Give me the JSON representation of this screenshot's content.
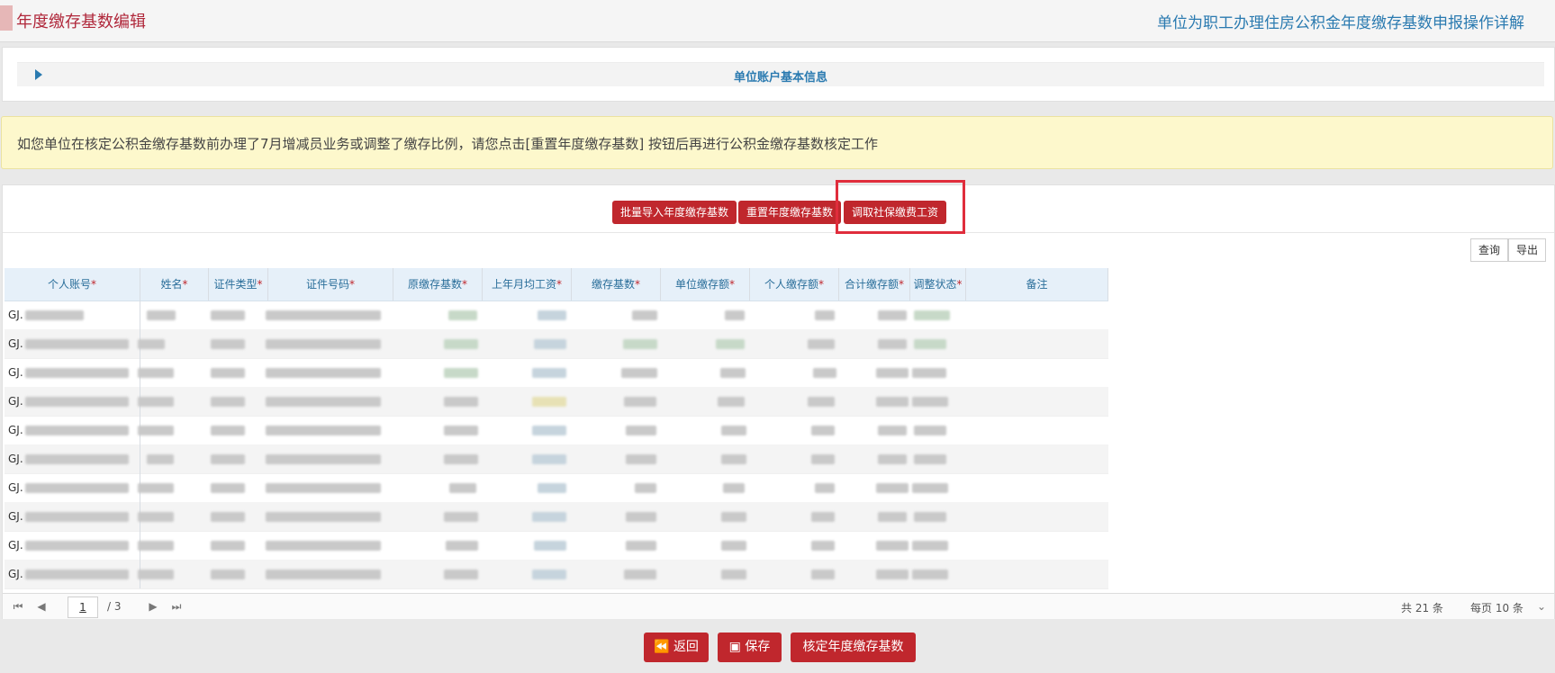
{
  "page": {
    "title": "年度缴存基数编辑",
    "help_link": "单位为职工办理住房公积金年度缴存基数申报操作详解"
  },
  "info_panel": {
    "label": "单位账户基本信息"
  },
  "notice": "如您单位在核定公积金缴存基数前办理了7月增减员业务或调整了缴存比例，请您点击[重置年度缴存基数] 按钮后再进行公积金缴存基数核定工作",
  "toolbar": {
    "import_label": "批量导入年度缴存基数",
    "reset_label": "重置年度缴存基数",
    "fetch_label": "调取社保缴费工资"
  },
  "query": {
    "search_label": "查询",
    "export_label": "导出"
  },
  "columns": [
    "个人账号",
    "姓名",
    "证件类型",
    "证件号码",
    "原缴存基数",
    "上年月均工资",
    "缴存基数",
    "单位缴存额",
    "个人缴存额",
    "合计缴存额",
    "调整状态",
    "备注"
  ],
  "rows": [
    {
      "acct": "GJ."
    },
    {
      "acct": "GJ."
    },
    {
      "acct": "GJ."
    },
    {
      "acct": "GJ."
    },
    {
      "acct": "GJ."
    },
    {
      "acct": "GJ."
    },
    {
      "acct": "GJ."
    },
    {
      "acct": "GJ."
    },
    {
      "acct": "GJ."
    },
    {
      "acct": "GJ."
    }
  ],
  "pager": {
    "current_page": "1",
    "total_pages": "/ 3",
    "total_records": "共 21 条",
    "page_size": "每页 10 条"
  },
  "footer": {
    "back_label": "返回",
    "save_label": "保存",
    "confirm_label": "核定年度缴存基数"
  }
}
